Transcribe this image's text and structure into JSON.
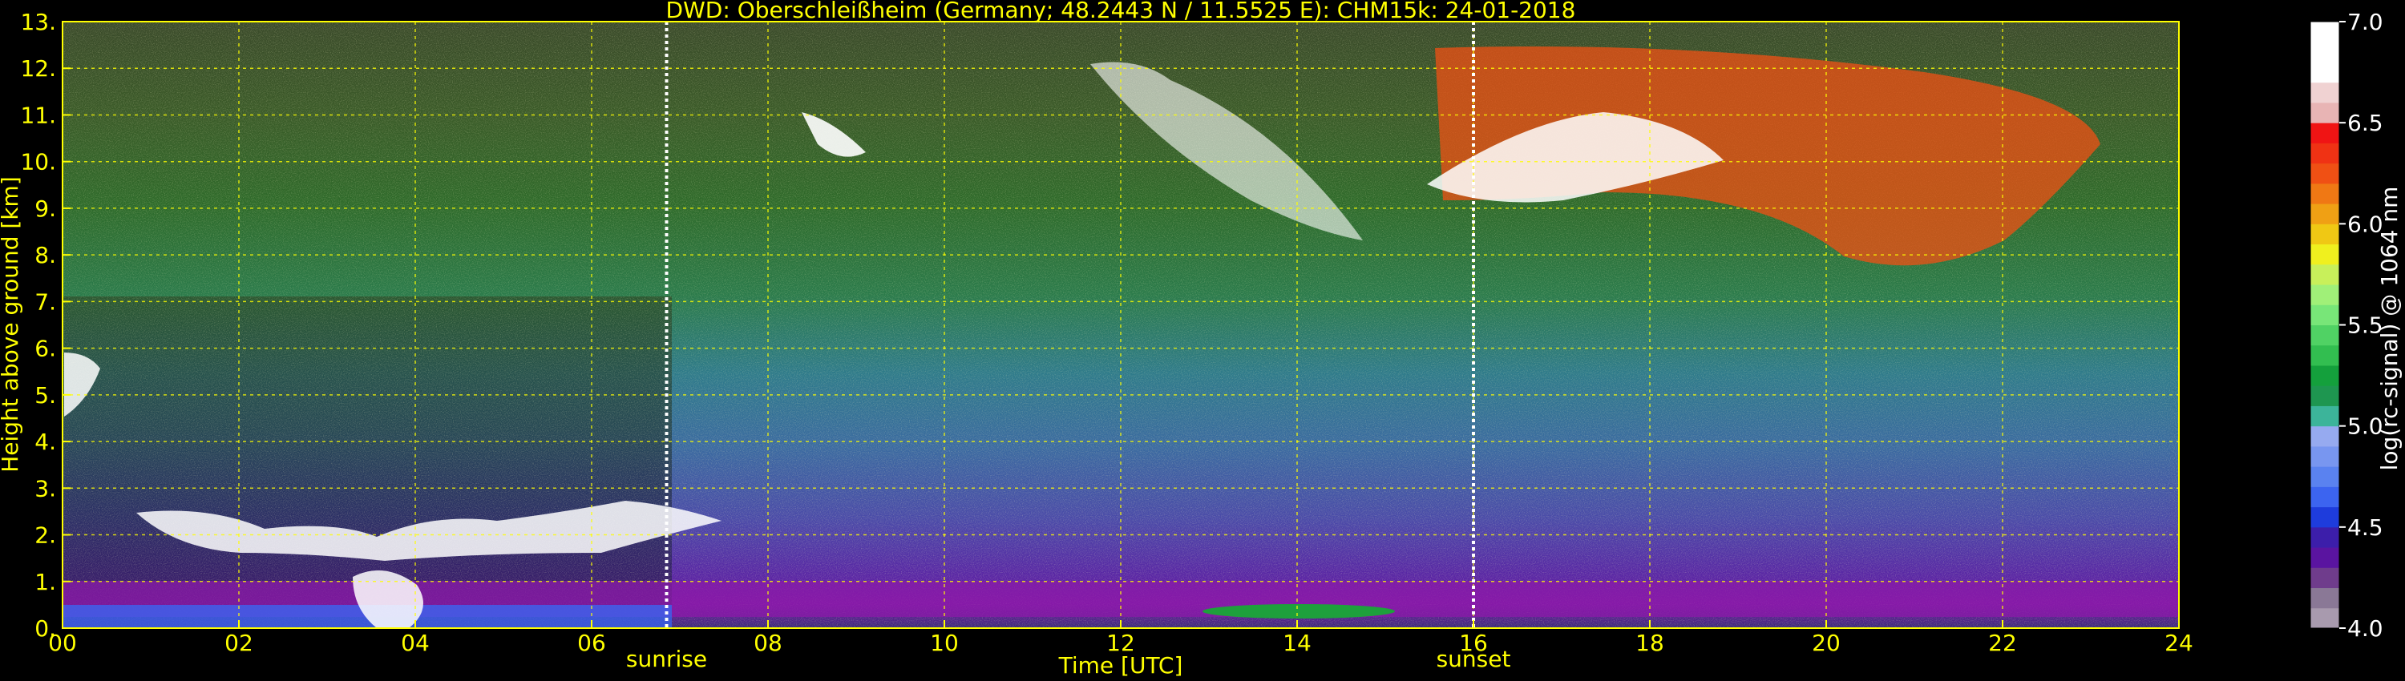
{
  "chart_data": {
    "type": "heatmap",
    "title": "DWD: Oberschleißheim (Germany; 48.2443 N / 11.5525 E):    CHM15k: 24-01-2018",
    "xlabel": "Time [UTC]",
    "ylabel": "Height above ground [km]",
    "xlim": [
      0,
      24
    ],
    "ylim": [
      0,
      13
    ],
    "x_ticks": [
      0,
      2,
      4,
      6,
      8,
      10,
      12,
      14,
      16,
      18,
      20,
      22,
      24
    ],
    "x_tick_labels": [
      "00",
      "02",
      "04",
      "06",
      "08",
      "10",
      "12",
      "14",
      "16",
      "18",
      "20",
      "22",
      "24"
    ],
    "y_ticks": [
      0,
      1,
      2,
      3,
      4,
      5,
      6,
      7,
      8,
      9,
      10,
      11,
      12,
      13
    ],
    "y_tick_labels": [
      "0.",
      "1.",
      "2.",
      "3.",
      "4.",
      "5.",
      "6.",
      "7.",
      "8.",
      "9.",
      "10.",
      "11.",
      "12.",
      "13."
    ],
    "grid": true,
    "markers": [
      {
        "label": "sunrise",
        "x": 6.85
      },
      {
        "label": "sunset",
        "x": 16.0
      }
    ],
    "colorbar": {
      "label": "log(rc-signal) @ 1064 nm",
      "range": [
        4.0,
        7.0
      ],
      "ticks": [
        4.0,
        4.5,
        5.0,
        5.5,
        6.0,
        6.5,
        7.0
      ],
      "tick_labels": [
        "4.0",
        "4.5",
        "5.0",
        "5.5",
        "6.0",
        "6.5",
        "7.0"
      ],
      "colors": [
        "#a89aae",
        "#8a7896",
        "#6f3c8c",
        "#5a14a0",
        "#3c1eaa",
        "#1e3cdc",
        "#3c64f0",
        "#5a82f0",
        "#7896f0",
        "#96aaf0",
        "#3cb49a",
        "#1e9650",
        "#14a03c",
        "#32be50",
        "#50d264",
        "#78e678",
        "#a0f078",
        "#c8f05a",
        "#f0f01e",
        "#f0c814",
        "#f0a014",
        "#f07814",
        "#f05014",
        "#f03214",
        "#f01414",
        "#e8b4b4",
        "#f0d2d2",
        "#ffffff",
        "#ffffff",
        "#ffffff"
      ]
    }
  }
}
